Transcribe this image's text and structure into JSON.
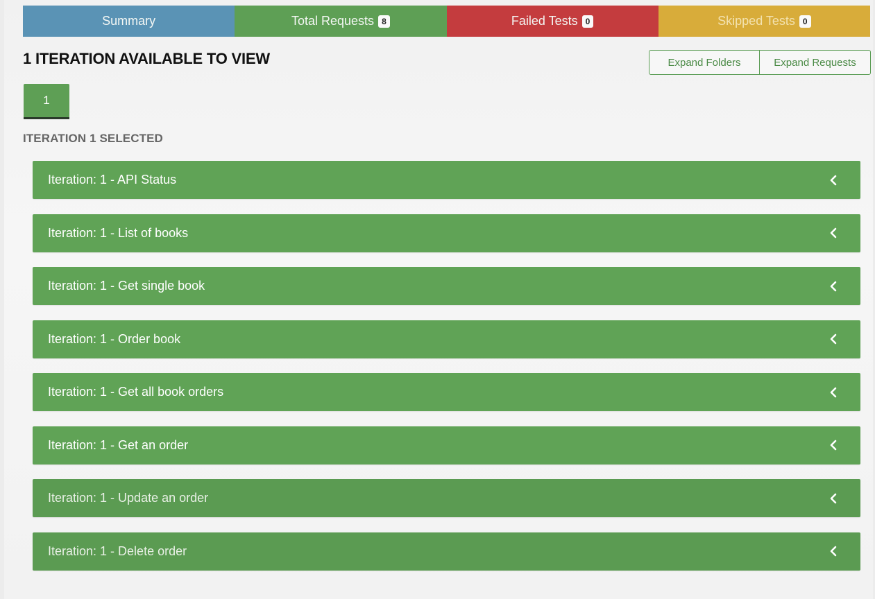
{
  "colors": {
    "summary": "#5a93b5",
    "total": "#5e9f55",
    "failed": "#c43c3e",
    "skipped": "#d8ac3a",
    "row": "#60a356"
  },
  "tabs": {
    "summary": "Summary",
    "total_requests": "Total Requests",
    "total_requests_count": "8",
    "failed_tests": "Failed Tests",
    "failed_tests_count": "0",
    "skipped_tests": "Skipped Tests",
    "skipped_tests_count": "0"
  },
  "heading": "1 ITERATION AVAILABLE TO VIEW",
  "buttons": {
    "expand_folders": "Expand Folders",
    "expand_requests": "Expand Requests"
  },
  "iteration_tab": "1",
  "selected_label": "ITERATION 1 SELECTED",
  "rows": [
    {
      "label": "Iteration: 1 - API Status",
      "icon": "chevron-left-icon"
    },
    {
      "label": "Iteration: 1 - List of books",
      "icon": "chevron-left-icon"
    },
    {
      "label": "Iteration: 1 - Get single book",
      "icon": "chevron-left-icon"
    },
    {
      "label": "Iteration: 1 - Order book",
      "icon": "chevron-left-icon"
    },
    {
      "label": "Iteration: 1 - Get all book orders",
      "icon": "chevron-left-icon"
    },
    {
      "label": "Iteration: 1 - Get an order",
      "icon": "chevron-left-icon"
    },
    {
      "label": "Iteration: 1 - Update an order",
      "icon": "chevron-left-icon"
    },
    {
      "label": "Iteration: 1 - Delete order",
      "icon": "chevron-left-icon"
    }
  ]
}
